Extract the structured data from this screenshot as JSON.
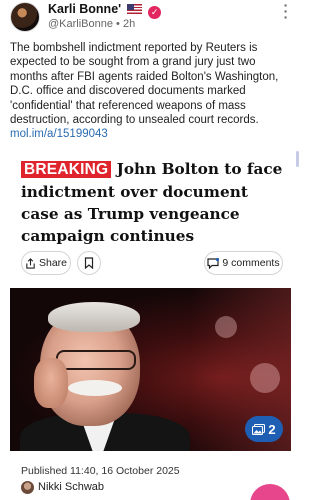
{
  "post": {
    "author_name": "Karli Bonne'",
    "handle": "@KarliBonne",
    "separator": "•",
    "time_ago": "2h",
    "body": "The bombshell indictment reported by Reuters is expected to be sought from a grand jury just two months after FBI agents raided Bolton's Washington, D.C. office and discovered documents marked 'confidential' that referenced weapons of mass destruction, according to unsealed court records.",
    "link": "mol.im/a/15199043"
  },
  "article": {
    "badge": "BREAKING",
    "headline": "John Bolton to face indictment over document case as Trump vengeance campaign continues",
    "share_label": "Share",
    "comments_label": "9 comments",
    "gallery_count": "2",
    "published": "Published 11:40, 16 October 2025",
    "author": "Nikki Schwab"
  },
  "colors": {
    "breaking_red": "#e0242d",
    "link_blue": "#2b6cb0",
    "gallery_blue": "#1e5fb4",
    "fab_pink": "#e8468c",
    "verified_pink": "#e2265f"
  },
  "icons": {
    "share": "share-icon",
    "bookmark": "bookmark-icon",
    "comment": "comment-icon",
    "gallery": "gallery-icon",
    "more": "more-vertical-icon",
    "verified": "verified-icon",
    "flag": "us-flag-icon"
  }
}
